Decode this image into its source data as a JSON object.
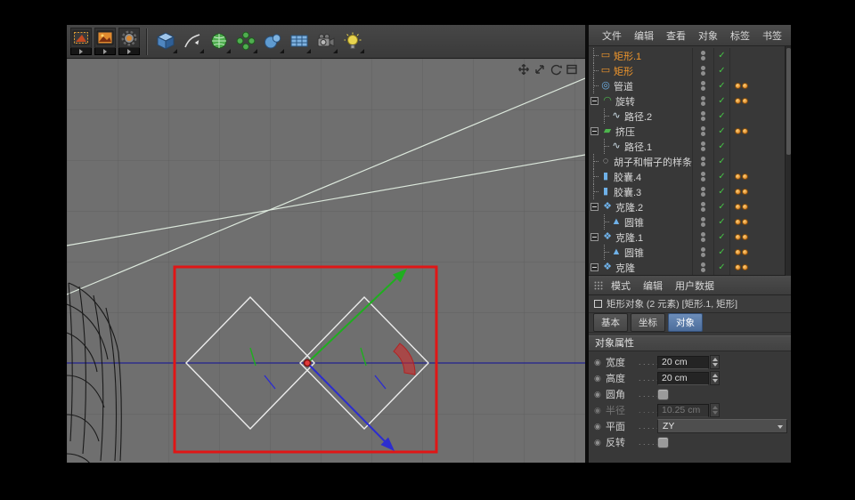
{
  "colors": {
    "selection_red": "#e01616",
    "axis_green": "#1fae1f",
    "axis_blue": "#2d2dcf",
    "accent_orange": "#f0962c",
    "check_green": "#45c445",
    "tab_active_blue": "#4c6d9b"
  },
  "toolbar": {
    "render_buttons": [
      {
        "name": "render-view"
      },
      {
        "name": "render-to-picture-viewer"
      },
      {
        "name": "edit-render-settings"
      }
    ],
    "tools": [
      {
        "name": "add-cube"
      },
      {
        "name": "freehand-spline"
      },
      {
        "name": "subdivision-surface"
      },
      {
        "name": "mograph-array"
      },
      {
        "name": "metaball"
      },
      {
        "name": "floor-grid"
      },
      {
        "name": "camera"
      },
      {
        "name": "light"
      }
    ]
  },
  "viewport": {
    "nav_icons": [
      "pan-icon",
      "zoom-icon",
      "rotate-icon",
      "maximize-icon"
    ]
  },
  "object_manager": {
    "menu": [
      "文件",
      "编辑",
      "查看",
      "对象",
      "标签",
      "书签"
    ],
    "rows": [
      {
        "label": "矩形.1",
        "glyph": "▭",
        "selected": true,
        "check": "✓",
        "tag": false
      },
      {
        "label": "矩形",
        "glyph": "▭",
        "selected": true,
        "check": "✓",
        "tag": false
      },
      {
        "label": "管道",
        "glyph": "◎",
        "selected": false,
        "check": "✓",
        "tag": true
      },
      {
        "label": "旋转",
        "glyph": "◠",
        "selected": false,
        "check": "✓",
        "tag": true,
        "expanded": true
      },
      {
        "label": "路径.2",
        "glyph": "∿",
        "selected": false,
        "check": "✓",
        "tag": false
      },
      {
        "label": "挤压",
        "glyph": "▰",
        "selected": false,
        "check": "✓",
        "tag": true,
        "expanded": true
      },
      {
        "label": "路径.1",
        "glyph": "∿",
        "selected": false,
        "check": "✓",
        "tag": false
      },
      {
        "label": "胡子和帽子的样条",
        "glyph": "◌",
        "selected": false,
        "check": "✓",
        "tag": false
      },
      {
        "label": "胶囊.4",
        "glyph": "▮",
        "selected": false,
        "check": "✓",
        "tag": true
      },
      {
        "label": "胶囊.3",
        "glyph": "▮",
        "selected": false,
        "check": "✓",
        "tag": true
      },
      {
        "label": "克隆.2",
        "glyph": "❖",
        "selected": false,
        "check": "✓",
        "tag": true,
        "expanded": true
      },
      {
        "label": "圆锥",
        "glyph": "▲",
        "selected": false,
        "check": "✓",
        "tag": true
      },
      {
        "label": "克隆.1",
        "glyph": "❖",
        "selected": false,
        "check": "✓",
        "tag": true,
        "expanded": true
      },
      {
        "label": "圆锥",
        "glyph": "▲",
        "selected": false,
        "check": "✓",
        "tag": true
      },
      {
        "label": "克隆",
        "glyph": "❖",
        "selected": false,
        "check": "✓",
        "tag": true,
        "expanded": true
      }
    ]
  },
  "attribute_manager": {
    "menu": [
      "模式",
      "编辑",
      "用户数据"
    ],
    "info": "矩形对象 (2 元素) [矩形.1, 矩形]",
    "tabs": [
      "基本",
      "坐标",
      "对象"
    ],
    "active_tab": "对象",
    "section_title": "对象属性",
    "bullet": "◉",
    "leader": ". . . . . .",
    "rows": [
      {
        "label": "宽度",
        "control": "stepper",
        "value": "20 cm"
      },
      {
        "label": "高度",
        "control": "stepper",
        "value": "20 cm"
      },
      {
        "label": "圆角",
        "control": "checkbox",
        "checked": false
      },
      {
        "label": "半径",
        "control": "stepper",
        "value": "10.25 cm",
        "disabled": true
      },
      {
        "label": "平面",
        "control": "select",
        "value": "ZY"
      },
      {
        "label": "反转",
        "control": "checkbox",
        "checked": false
      }
    ]
  }
}
